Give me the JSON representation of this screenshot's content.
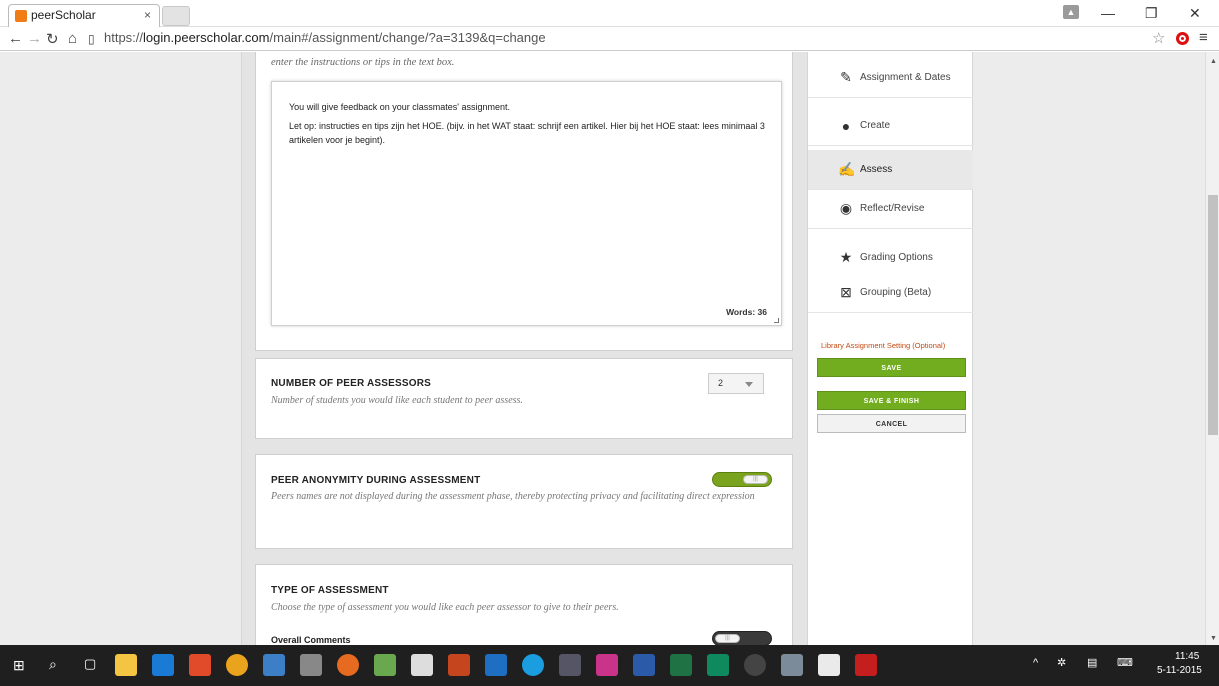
{
  "browser": {
    "tab_title": "peerScholar",
    "tab_close": "×",
    "url_prefix": "https://",
    "url_domain": "login.peerscholar.com",
    "url_path": "/main#/assignment/change/?a=3139&q=change"
  },
  "main": {
    "intro_text": "enter the instructions or tips in the text box.",
    "editor": {
      "line1": "You will give feedback on your classmates' assignment.",
      "line2": "Let op: instructies en tips zijn het HOE. (bijv. in het WAT staat: schrijf een artikel. Hier bij het HOE staat: lees minimaal 3 artikelen voor je begint).",
      "words_label": "Words: 36"
    },
    "peer_assessors": {
      "title": "NUMBER OF PEER ASSESSORS",
      "description": "Number of students you would like each student to peer assess.",
      "selected_value": "2"
    },
    "peer_anonymity": {
      "title": "PEER ANONYMITY DURING ASSESSMENT",
      "description": "Peers names are not displayed during the assessment phase, thereby protecting privacy and facilitating direct expression",
      "enabled": true
    },
    "assessment_type": {
      "title": "TYPE OF ASSESSMENT",
      "description": "Choose the type of assessment you would like each peer assessor to give to their peers.",
      "overall_comments_label": "Overall Comments",
      "overall_comments_enabled": false
    }
  },
  "sidebar": {
    "items": [
      {
        "label": "Assignment & Dates",
        "icon": "edit-icon"
      },
      {
        "label": "Create",
        "icon": "lightbulb-icon"
      },
      {
        "label": "Assess",
        "icon": "assess-icon",
        "active": true
      },
      {
        "label": "Reflect/Revise",
        "icon": "reflect-icon"
      },
      {
        "label": "Grading Options",
        "icon": "star-icon"
      },
      {
        "label": "Grouping (Beta)",
        "icon": "grouping-icon"
      }
    ],
    "library_link": "Library Assignment Setting (Optional)",
    "save_label": "SAVE",
    "save_finish_label": "SAVE & FINISH",
    "cancel_label": "CANCEL"
  },
  "taskbar": {
    "time": "11:45",
    "date": "5-11-2015"
  },
  "colors": {
    "accent_green": "#72ad20",
    "library_link": "#c34a12"
  }
}
